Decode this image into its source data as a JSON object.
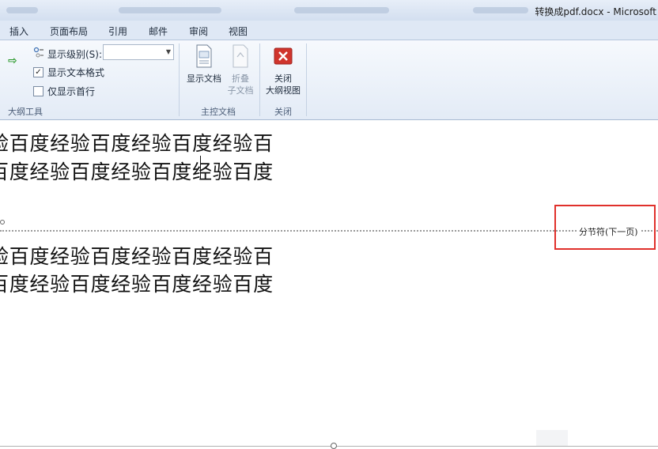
{
  "window": {
    "title": "转换成pdf.docx - Microsoft"
  },
  "menu": [
    "插入",
    "页面布局",
    "引用",
    "邮件",
    "审阅",
    "视图"
  ],
  "ribbon": {
    "outline_tools": {
      "show_level_label": "显示级别(S):",
      "show_level_value": "",
      "show_text_format": {
        "label": "显示文本格式",
        "checked": true
      },
      "first_line_only": {
        "label": "仅显示首行",
        "checked": false
      },
      "group_label": "大纲工具"
    },
    "master_document": {
      "show_document": "显示文档",
      "collapse_line1": "折叠",
      "collapse_line2": "子文档",
      "group_label": "主控文档"
    },
    "close": {
      "line1": "关闭",
      "line2": "大纲视图",
      "group_label": "关闭"
    }
  },
  "document": {
    "lines_before_break": [
      "验百度经验百度经验百度经验百",
      "百度经验百度经验百度经验百度"
    ],
    "section_break_label": "分节符(下一页)",
    "lines_after_break": [
      "验百度经验百度经验百度经验百",
      "百度经验百度经验百度经验百度"
    ]
  },
  "colors": {
    "highlight_box": "#e0302b",
    "ribbon_bg": "#e3ebf6",
    "close_icon": "#d0342c"
  }
}
